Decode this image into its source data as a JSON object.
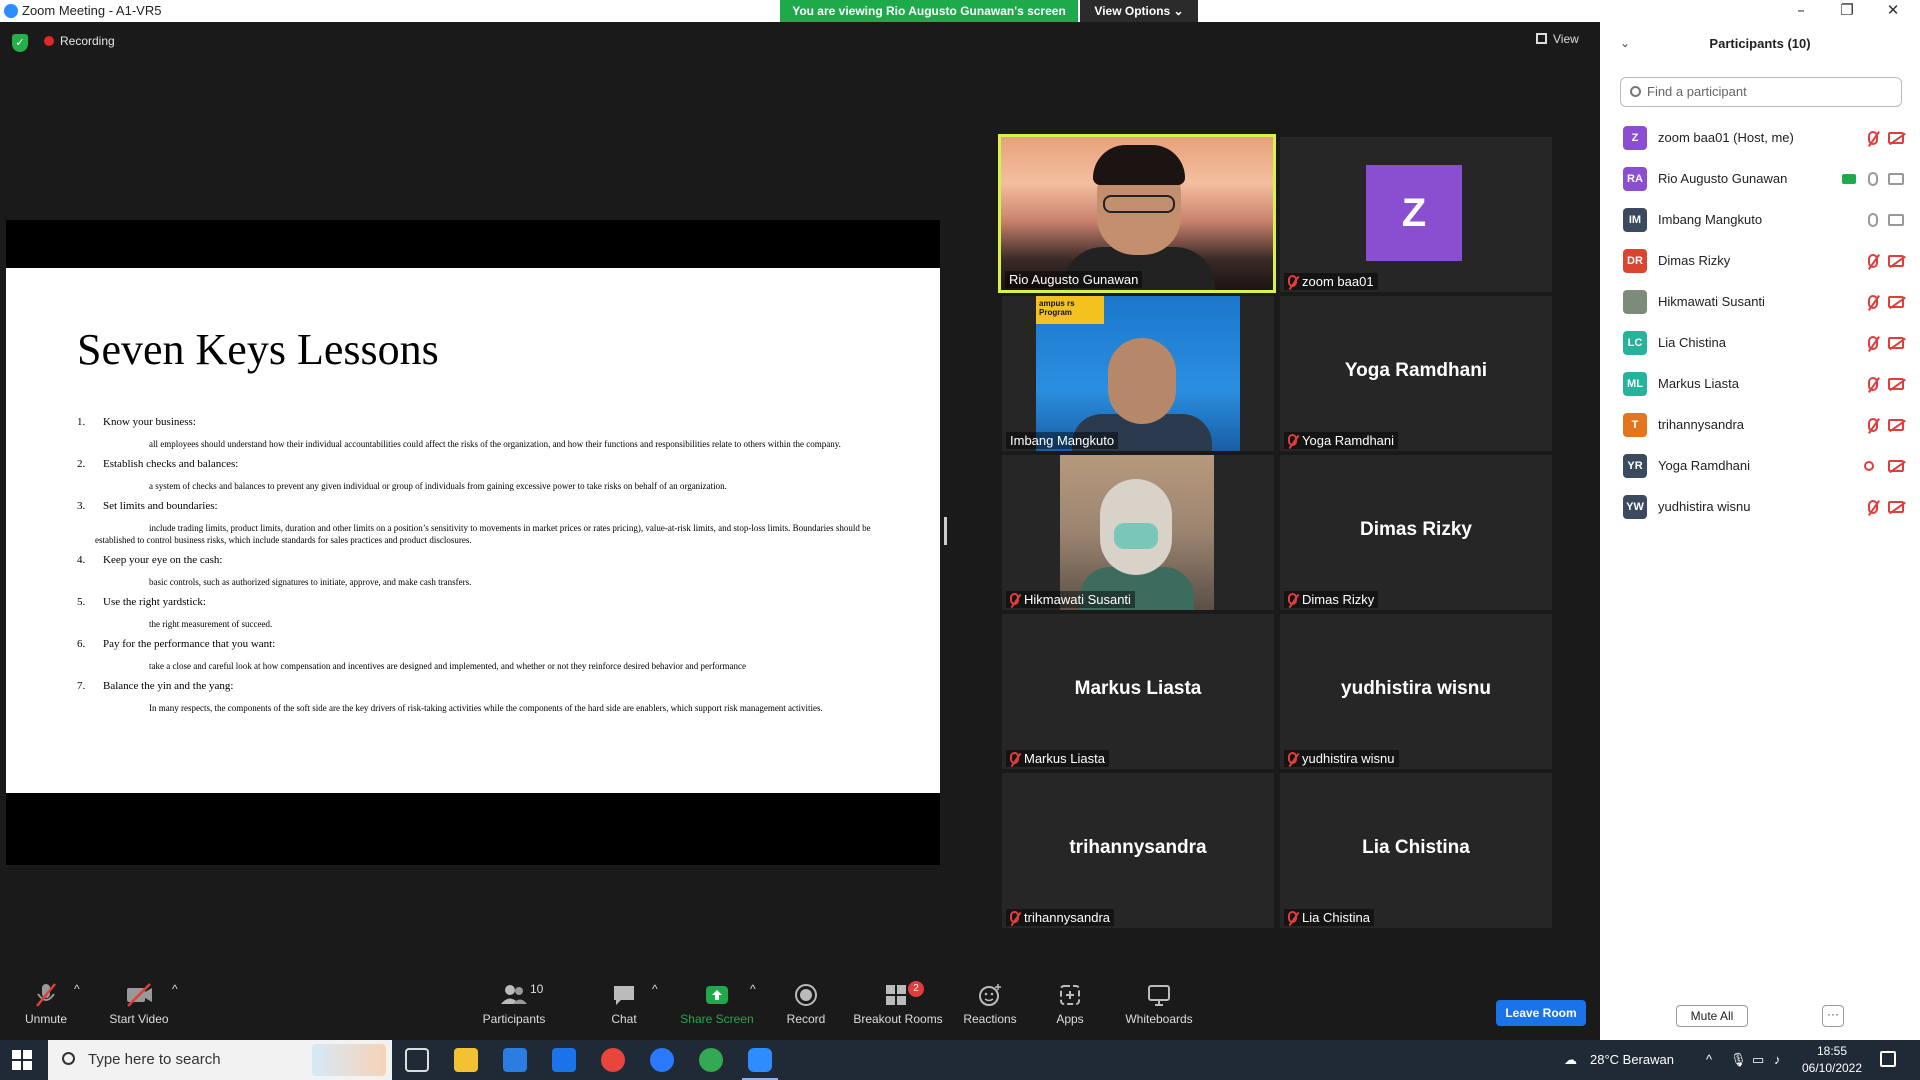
{
  "window": {
    "title": "Zoom Meeting - A1-VR5",
    "viewing_banner": "You are viewing Rio Augusto Gunawan's screen",
    "view_options": "View Options ⌄",
    "controls": [
      "–",
      "❐",
      "✕"
    ]
  },
  "meeting": {
    "recording_label": "Recording",
    "view_label": "View"
  },
  "slide": {
    "title": "Seven Keys Lessons",
    "items": [
      {
        "num": "1.",
        "heading": "Know your business:",
        "text": "all employees should understand how their individual accountabilities could affect the risks of the organization, and how their functions and responsibilities relate to others within the company."
      },
      {
        "num": "2.",
        "heading": "Establish checks and balances:",
        "text": "a system of checks and balances to prevent any given individual or group of individuals from gaining excessive power to take risks on behalf of an organization."
      },
      {
        "num": "3.",
        "heading": "Set limits and boundaries:",
        "text": "include trading limits, product limits, duration and other limits on a position’s sensitivity to movements in market prices or rates pricing), value-at-risk limits, and stop-loss limits. Boundaries should be established to control business risks, which include standards for sales practices and product disclosures."
      },
      {
        "num": "4.",
        "heading": "Keep your eye on the cash:",
        "text": "basic controls, such as authorized signatures to initiate, approve, and make cash transfers."
      },
      {
        "num": "5.",
        "heading": "Use the right yardstick:",
        "text": "the right measurement of succeed."
      },
      {
        "num": "6.",
        "heading": "Pay for the performance that you want:",
        "text": "take a close and careful look at how compensation and incentives are designed and implemented, and whether or not they reinforce desired behavior and performance"
      },
      {
        "num": "7.",
        "heading": "Balance the yin and the yang:",
        "text": "In many respects, the components of the soft side are the key drivers of risk-taking activities while the components of the hard side are enablers, which support risk management activities."
      }
    ]
  },
  "gallery": {
    "rio": {
      "label": "Rio Augusto Gunawan"
    },
    "zoom": {
      "initial": "Z",
      "label": "zoom baa01"
    },
    "imbang": {
      "label": "Imbang Mangkuto",
      "banner": "ampus\nrs Program"
    },
    "yoga": {
      "name": "Yoga Ramdhani",
      "label": "Yoga Ramdhani"
    },
    "hikmawati": {
      "label": "Hikmawati Susanti"
    },
    "dimas": {
      "name": "Dimas Rizky",
      "label": "Dimas Rizky"
    },
    "markus": {
      "name": "Markus Liasta",
      "label": "Markus Liasta"
    },
    "yudhistira": {
      "name": "yudhistira wisnu",
      "label": "yudhistira wisnu"
    },
    "trihanny": {
      "name": "trihannysandra",
      "label": "trihannysandra"
    },
    "lia": {
      "name": "Lia Chistina",
      "label": "Lia Chistina"
    }
  },
  "toolbar": {
    "unmute": "Unmute",
    "start_video": "Start Video",
    "participants": "Participants",
    "participants_count": "10",
    "chat": "Chat",
    "share_screen": "Share Screen",
    "record": "Record",
    "breakout_rooms": "Breakout Rooms",
    "breakout_badge": "2",
    "reactions": "Reactions",
    "apps": "Apps",
    "whiteboards": "Whiteboards",
    "leave_room": "Leave Room",
    "caret": "^"
  },
  "panel": {
    "chevron": "⌄",
    "title": "Participants (10)",
    "search_placeholder": "Find a participant",
    "participants": [
      {
        "initials": "Z",
        "name": "zoom baa01 (Host, me)",
        "color": "#8a4ed1"
      },
      {
        "initials": "RA",
        "name": "Rio Augusto Gunawan",
        "color": "#8a4ed1"
      },
      {
        "initials": "IM",
        "name": "Imbang Mangkuto",
        "color": "#3b4a5e"
      },
      {
        "initials": "DR",
        "name": "Dimas Rizky",
        "color": "#d9452f"
      },
      {
        "initials": "",
        "name": "Hikmawati Susanti",
        "color": "#7d8b7a"
      },
      {
        "initials": "LC",
        "name": "Lia Chistina",
        "color": "#25b39b"
      },
      {
        "initials": "ML",
        "name": "Markus Liasta",
        "color": "#25b39b"
      },
      {
        "initials": "T",
        "name": "trihannysandra",
        "color": "#e2751d"
      },
      {
        "initials": "YR",
        "name": "Yoga Ramdhani",
        "color": "#3b4a5e"
      },
      {
        "initials": "YW",
        "name": "yudhistira wisnu",
        "color": "#3b4a5e"
      }
    ],
    "mute_all": "Mute All",
    "more": "···"
  },
  "taskbar": {
    "search_placeholder": "Type here to search",
    "weather": "28°C  Berawan",
    "time": "18:55",
    "date": "06/10/2022"
  }
}
